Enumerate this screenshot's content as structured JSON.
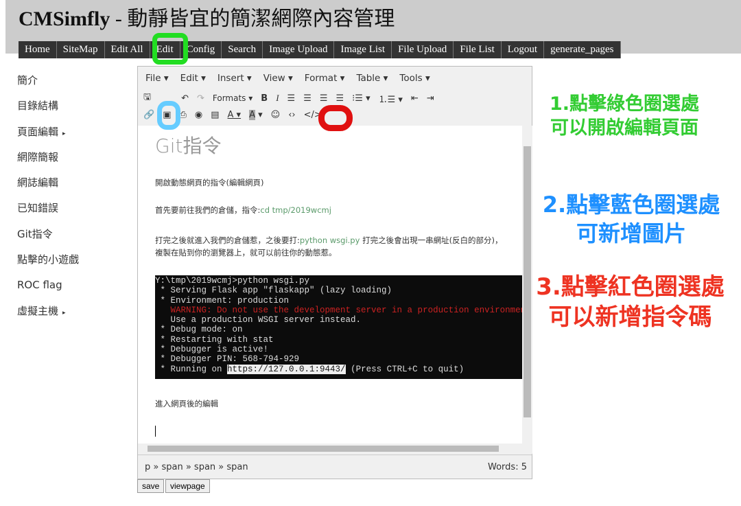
{
  "header": {
    "title_brand": "CMSimfly",
    "title_rest": " - 動靜皆宜的簡潔網際內容管理"
  },
  "nav": [
    "Home",
    "SiteMap",
    "Edit All",
    "Edit",
    "Config",
    "Search",
    "Image Upload",
    "Image List",
    "File Upload",
    "File List",
    "Logout",
    "generate_pages"
  ],
  "sidebar": [
    {
      "label": "簡介"
    },
    {
      "label": "目錄結構"
    },
    {
      "label": "頁面編輯",
      "arrow": "▸"
    },
    {
      "label": "網際簡報"
    },
    {
      "label": "網誌編輯"
    },
    {
      "label": "已知錯誤"
    },
    {
      "label": "Git指令"
    },
    {
      "label": "點擊的小遊戲"
    },
    {
      "label": "ROC flag"
    },
    {
      "label": "虛擬主機",
      "arrow": "▸"
    }
  ],
  "editor": {
    "menu": [
      "File ▾",
      "Edit ▾",
      "Insert ▾",
      "View ▾",
      "Format ▾",
      "Table ▾",
      "Tools ▾"
    ],
    "formats_label": "Formats ▾",
    "heading": "Git指令",
    "p1": "開啟動態網頁的指令(編輯網頁)",
    "p2_text": "首先要前往我們的倉儲，指令:",
    "p2_code": "cd tmp/2019wcmj",
    "p3_a": "打完之後就進入我們的倉儲惹，之後要打:",
    "p3_code": "python wsgi.py",
    "p3_b": " 打完之後會出現一串網址(反白的部分)，複製在貼到你的瀏覽器上，就可以前往你的動態惹。",
    "terminal": [
      "Y:\\tmp\\2019wcmj>python wsgi.py",
      " * Serving Flask app \"flaskapp\" (lazy loading)",
      " * Environment: production",
      "   WARNING: Do not use the development server in a production environment.",
      "   Use a production WSGI server instead.",
      " * Debug mode: on",
      " * Restarting with stat",
      " * Debugger is active!",
      " * Debugger PIN: 568-794-929"
    ],
    "terminal_run_prefix": " * Running on ",
    "terminal_url": "https://127.0.0.1:9443/",
    "terminal_run_suffix": " (Press CTRL+C to quit)",
    "p4": "進入網頁後的編輯",
    "path": "p » span » span » span",
    "words": "Words: 5"
  },
  "buttons": {
    "save": "save",
    "viewpage": "viewpage"
  },
  "annotations": {
    "green": "1.點擊綠色圈選處可以開啟編輯頁面",
    "blue": "2.點擊藍色圈選處可新增圖片",
    "red": "3.點擊紅色圈選處可以新增指令碼",
    "colors": {
      "green": "#22cc22",
      "blue": "#1e90ff",
      "red": "#ee2222"
    }
  }
}
